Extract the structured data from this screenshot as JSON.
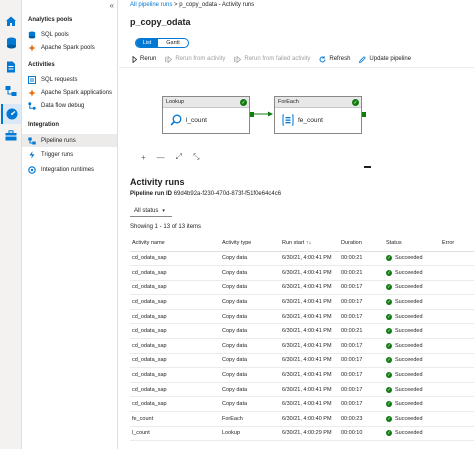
{
  "rail": {
    "icons": [
      "home-icon",
      "database-icon",
      "document-icon",
      "pipeline-icon",
      "monitor-icon",
      "briefcase-icon"
    ]
  },
  "nav": {
    "collapse_glyph": "«",
    "sections": [
      {
        "label": "Analytics pools",
        "items": [
          {
            "label": "SQL pools",
            "icon": "sql-pool-icon"
          },
          {
            "label": "Apache Spark pools",
            "icon": "spark-pool-icon"
          }
        ]
      },
      {
        "label": "Activities",
        "items": [
          {
            "label": "SQL requests",
            "icon": "sql-request-icon"
          },
          {
            "label": "Apache Spark applications",
            "icon": "spark-app-icon"
          },
          {
            "label": "Data flow debug",
            "icon": "dataflow-icon"
          }
        ]
      },
      {
        "label": "Integration",
        "items": [
          {
            "label": "Pipeline runs",
            "icon": "pipeline-runs-icon"
          },
          {
            "label": "Trigger runs",
            "icon": "trigger-icon"
          },
          {
            "label": "Integration runtimes",
            "icon": "runtime-icon"
          }
        ]
      }
    ]
  },
  "breadcrumb": {
    "root": "All pipeline runs",
    "sep": ">",
    "current": "p_copy_odata - Activity runs"
  },
  "title": "p_copy_odata",
  "view_toggle": {
    "list": "List",
    "gantt": "Gantt"
  },
  "toolbar": {
    "rerun": "Rerun",
    "rerun_from_activity": "Rerun from activity",
    "rerun_from_failed": "Rerun from failed activity",
    "refresh": "Refresh",
    "update_pipeline": "Update pipeline"
  },
  "canvas": {
    "lookup": {
      "header": "Lookup",
      "name": "l_count"
    },
    "foreach": {
      "header": "ForEach",
      "name": "fe_count"
    },
    "zoom": {
      "plus": "+",
      "minus": "—",
      "fit": "⤢",
      "expand": "⤡"
    }
  },
  "runs": {
    "title": "Activity runs",
    "pipeline_run_id_label": "Pipeline run ID",
    "pipeline_run_id": "69d4b92a-f230-470d-873f-f51f0e64c4c6",
    "filter": "All status",
    "showing": "Showing 1 - 13 of 13 items",
    "columns": [
      "Activity name",
      "Activity type",
      "Run start ↑↓",
      "Duration",
      "Status",
      "Error"
    ],
    "rows": [
      [
        "cd_odata_sap",
        "Copy data",
        "6/30/21, 4:00:41 PM",
        "00:00:21",
        "Succeeded",
        ""
      ],
      [
        "cd_odata_sap",
        "Copy data",
        "6/30/21, 4:00:41 PM",
        "00:00:21",
        "Succeeded",
        ""
      ],
      [
        "cd_odata_sap",
        "Copy data",
        "6/30/21, 4:00:41 PM",
        "00:00:17",
        "Succeeded",
        ""
      ],
      [
        "cd_odata_sap",
        "Copy data",
        "6/30/21, 4:00:41 PM",
        "00:00:17",
        "Succeeded",
        ""
      ],
      [
        "cd_odata_sap",
        "Copy data",
        "6/30/21, 4:00:41 PM",
        "00:00:17",
        "Succeeded",
        ""
      ],
      [
        "cd_odata_sap",
        "Copy data",
        "6/30/21, 4:00:41 PM",
        "00:00:21",
        "Succeeded",
        ""
      ],
      [
        "cd_odata_sap",
        "Copy data",
        "6/30/21, 4:00:41 PM",
        "00:00:17",
        "Succeeded",
        ""
      ],
      [
        "cd_odata_sap",
        "Copy data",
        "6/30/21, 4:00:41 PM",
        "00:00:17",
        "Succeeded",
        ""
      ],
      [
        "cd_odata_sap",
        "Copy data",
        "6/30/21, 4:00:41 PM",
        "00:00:17",
        "Succeeded",
        ""
      ],
      [
        "cd_odata_sap",
        "Copy data",
        "6/30/21, 4:00:41 PM",
        "00:00:17",
        "Succeeded",
        ""
      ],
      [
        "cd_odata_sap",
        "Copy data",
        "6/30/21, 4:00:41 PM",
        "00:00:17",
        "Succeeded",
        ""
      ],
      [
        "fe_count",
        "ForEach",
        "6/30/21, 4:00:40 PM",
        "00:00:23",
        "Succeeded",
        ""
      ],
      [
        "l_count",
        "Lookup",
        "6/30/21, 4:00:29 PM",
        "00:00:10",
        "Succeeded",
        ""
      ]
    ]
  },
  "colors": {
    "accent": "#0078d4",
    "success": "#107c10"
  }
}
